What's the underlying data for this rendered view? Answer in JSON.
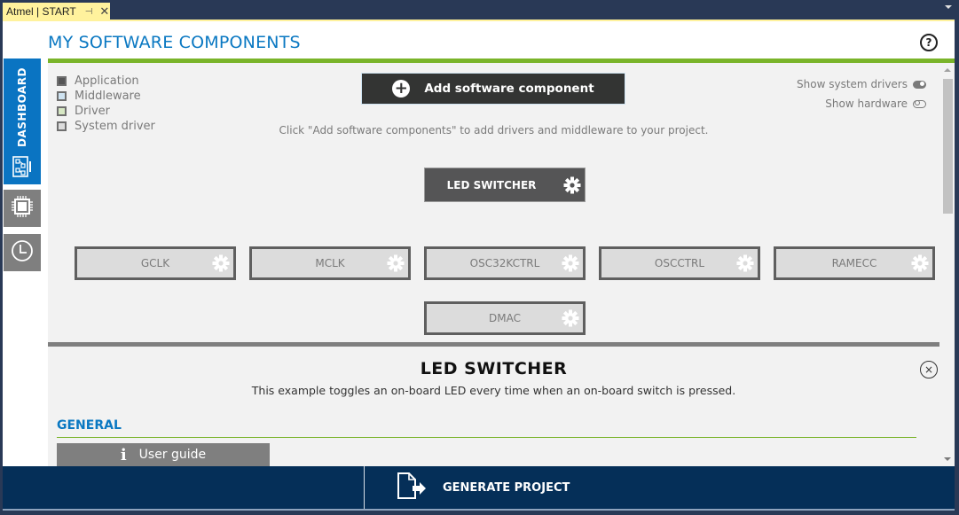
{
  "tab": {
    "title": "Atmel | START",
    "pin_icon": "pin-icon",
    "close_icon": "close-icon"
  },
  "header": {
    "title": "MY SOFTWARE COMPONENTS",
    "help_icon": "?"
  },
  "sidebar": {
    "items": [
      {
        "label": "DASHBOARD",
        "icon": "dashboard-diagram-icon",
        "active": true
      },
      {
        "label": "",
        "icon": "chip-icon",
        "active": false
      },
      {
        "label": "",
        "icon": "clock-icon",
        "active": false
      }
    ]
  },
  "legend": {
    "items": [
      {
        "label": "Application",
        "color": "#555556"
      },
      {
        "label": "Middleware",
        "color": "#cfe3f1"
      },
      {
        "label": "Driver",
        "color": "#d7e8c4"
      },
      {
        "label": "System driver",
        "color": "#dcdcdc"
      }
    ]
  },
  "toolbar": {
    "add_label": "Add software component",
    "hint": "Click \"Add software components\" to add drivers and middleware to your project."
  },
  "toggles": {
    "system_drivers": {
      "label": "Show system drivers",
      "on": true
    },
    "hardware": {
      "label": "Show hardware",
      "on": false
    }
  },
  "components": {
    "application": {
      "label": "LED SWITCHER"
    },
    "system_drivers": [
      {
        "label": "GCLK"
      },
      {
        "label": "MCLK"
      },
      {
        "label": "OSC32KCTRL"
      },
      {
        "label": "OSCCTRL"
      },
      {
        "label": "RAMECC"
      },
      {
        "label": "DMAC"
      }
    ]
  },
  "detail": {
    "title": "LED SWITCHER",
    "description": "This example toggles an on-board LED every time when an on-board switch is pressed.",
    "close_icon": "×",
    "section": "GENERAL",
    "user_guide_label": "User guide",
    "info_icon": "i"
  },
  "footer": {
    "generate_label": "GENERATE PROJECT"
  },
  "colors": {
    "accent_blue": "#0a78c2",
    "accent_green": "#7ab42a",
    "footer_navy": "#052f58",
    "tab_yellow": "#fff29d"
  }
}
